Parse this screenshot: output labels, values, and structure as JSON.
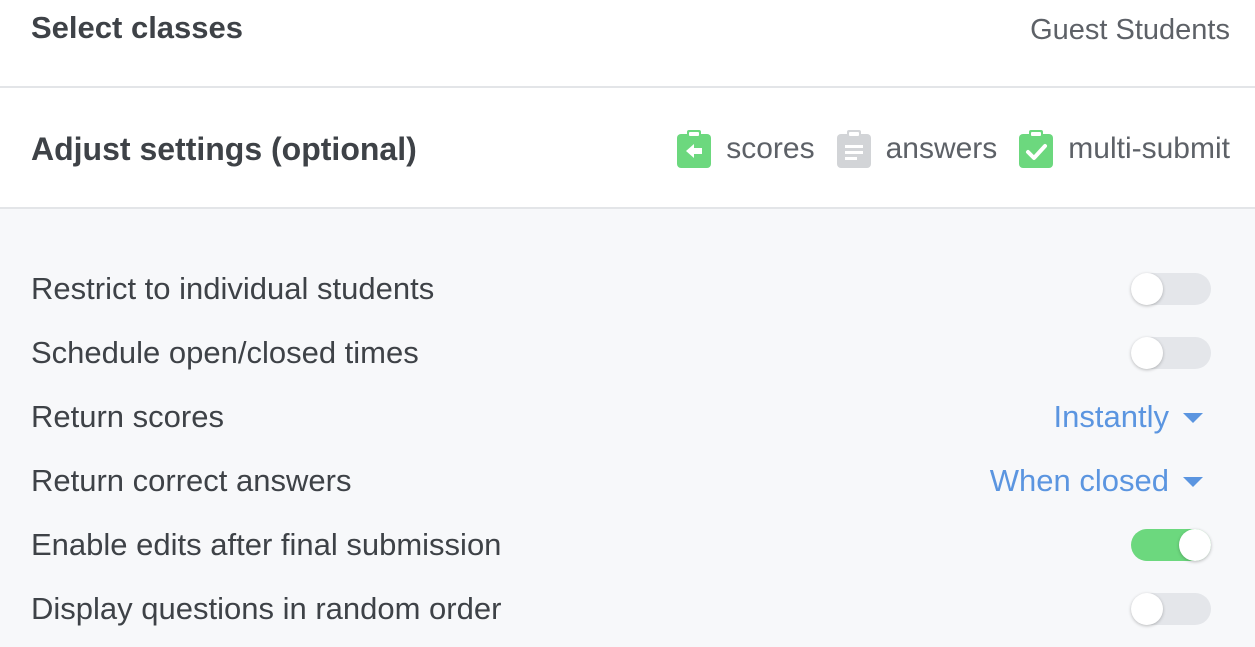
{
  "header": {
    "select_classes_title": "Select classes",
    "selected_class": "Guest Students"
  },
  "adjust": {
    "title": "Adjust settings (optional)",
    "indicators": [
      {
        "label": "scores",
        "icon": "clipboard-return-icon",
        "state": "enabled",
        "color": "#6cd87e"
      },
      {
        "label": "answers",
        "icon": "clipboard-text-icon",
        "state": "disabled",
        "color": "#d2d4d7"
      },
      {
        "label": "multi-submit",
        "icon": "clipboard-check-icon",
        "state": "enabled",
        "color": "#6cd87e"
      }
    ]
  },
  "settings": [
    {
      "label": "Restrict to individual students",
      "control": "toggle",
      "on": false
    },
    {
      "label": "Schedule open/closed times",
      "control": "toggle",
      "on": false
    },
    {
      "label": "Return scores",
      "control": "dropdown",
      "value": "Instantly"
    },
    {
      "label": "Return correct answers",
      "control": "dropdown",
      "value": "When closed"
    },
    {
      "label": "Enable edits after final submission",
      "control": "toggle",
      "on": true
    },
    {
      "label": "Display questions in random order",
      "control": "toggle",
      "on": false
    }
  ],
  "colors": {
    "accent_green": "#6cd87e",
    "link_blue": "#5b95e0",
    "toggle_off": "#e4e6ea",
    "panel_bg": "#f7f8fa"
  }
}
